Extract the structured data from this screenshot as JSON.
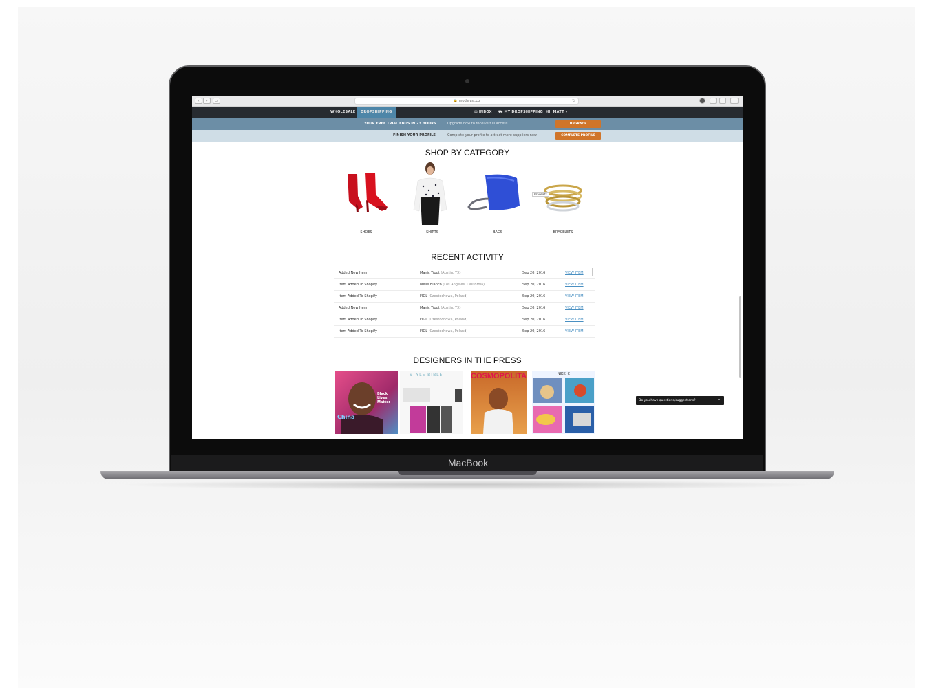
{
  "device": {
    "brand": "MacBook"
  },
  "browser": {
    "url": "modalyst.co"
  },
  "nav": {
    "wholesale": "WHOLESALE",
    "dropshipping": "DROPSHIPPING",
    "inbox": "INBOX",
    "my_dropshipping": "MY DROPSHIPPING",
    "user": "HI, MATT"
  },
  "trial_banner": {
    "text": "YOUR FREE TRIAL ENDS IN 23 HOURS",
    "subtext": "Upgrade now to receive full access",
    "button": "UPGRADE"
  },
  "profile_banner": {
    "text": "FINISH YOUR PROFILE",
    "subtext": "Complete your profile to attract more suppliers now",
    "button": "COMPLETE PROFILE"
  },
  "categories": {
    "title": "SHOP BY CATEGORY",
    "tooltip": "Bracelets",
    "items": [
      {
        "label": "SHOES",
        "icon": "shoes-image"
      },
      {
        "label": "SHIRTS",
        "icon": "shirt-model-image"
      },
      {
        "label": "BAGS",
        "icon": "bag-image"
      },
      {
        "label": "BRACELETS",
        "icon": "bracelets-image"
      }
    ]
  },
  "activity": {
    "title": "RECENT ACTIVITY",
    "rows": [
      {
        "action": "Added New Item",
        "supplier": "Manic Trout",
        "location": "(Austin, TX)",
        "date": "Sep 20, 2016",
        "link": "VIEW ITEM"
      },
      {
        "action": "Item Added To Shopify",
        "supplier": "Melie Bianco",
        "location": "(Los Angeles, California)",
        "date": "Sep 20, 2016",
        "link": "VIEW ITEM"
      },
      {
        "action": "Item Added To Shopify",
        "supplier": "FIGL",
        "location": "(Czestochowa, Poland)",
        "date": "Sep 20, 2016",
        "link": "VIEW ITEM"
      },
      {
        "action": "Added New Item",
        "supplier": "Manic Trout",
        "location": "(Austin, TX)",
        "date": "Sep 20, 2016",
        "link": "VIEW ITEM"
      },
      {
        "action": "Item Added To Shopify",
        "supplier": "FIGL",
        "location": "(Czestochowa, Poland)",
        "date": "Sep 20, 2016",
        "link": "VIEW ITEM"
      },
      {
        "action": "Item Added To Shopify",
        "supplier": "FIGL",
        "location": "(Czestochowa, Poland)",
        "date": "Sep 20, 2016",
        "link": "VIEW ITEM"
      }
    ]
  },
  "press": {
    "title": "DESIGNERS IN THE PRESS",
    "items": [
      {
        "masthead": "",
        "cover_lines": [
          "Black",
          "Lives",
          "Matter"
        ],
        "sub": "China"
      },
      {
        "masthead": "STYLE BIBLE"
      },
      {
        "masthead": "COSMOPOLITAN"
      },
      {
        "masthead": "NIKKI C"
      }
    ]
  },
  "chat": {
    "label": "Do you have questions/suggestions?"
  },
  "colors": {
    "nav_bg": "#272b30",
    "nav_active": "#4e86a8",
    "trial_bg": "#6c8ea6",
    "profile_bg": "#cfdde6",
    "button_orange": "#d0752a",
    "link_blue": "#4a90c2"
  }
}
